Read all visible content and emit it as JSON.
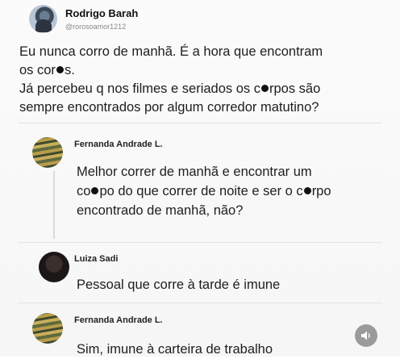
{
  "post": {
    "author_name": "Rodrigo Barah",
    "author_handle": "@rorosoamor1212",
    "line1": "Eu nunca corro de manhã. É a hora que encontram",
    "line2_a": "os cor",
    "line2_b": "s.",
    "line3_a": "Já percebeu q nos filmes e seriados os c",
    "line3_b": "rpos são",
    "line4": "sempre encontrados por algum corredor matutino?"
  },
  "comments": [
    {
      "name": "Fernanda Andrade L.",
      "line1": "Melhor correr de manhã e encontrar um",
      "line2_a": "co",
      "line2_b": "po do que correr de noite e ser o c",
      "line2_c": "rpo",
      "line3": "encontrado de manhã, não?"
    },
    {
      "name": "Luiza Sadi",
      "text": "Pessoal que corre à tarde é imune"
    },
    {
      "name": "Fernanda Andrade L.",
      "text": "Sim, imune à carteira de trabalho"
    }
  ],
  "icons": {
    "sound": "speaker-icon"
  }
}
